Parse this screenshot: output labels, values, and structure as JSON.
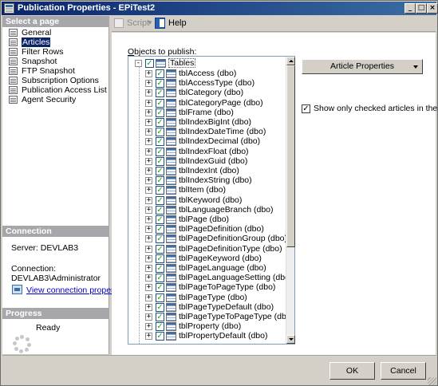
{
  "window": {
    "title": "Publication Properties - EPiTest2"
  },
  "left_pane": {
    "select_header": "Select a page",
    "pages": [
      {
        "label": "General",
        "selected": false
      },
      {
        "label": "Articles",
        "selected": true
      },
      {
        "label": "Filter Rows",
        "selected": false
      },
      {
        "label": "Snapshot",
        "selected": false
      },
      {
        "label": "FTP Snapshot",
        "selected": false
      },
      {
        "label": "Subscription Options",
        "selected": false
      },
      {
        "label": "Publication Access List",
        "selected": false
      },
      {
        "label": "Agent Security",
        "selected": false
      }
    ],
    "connection_header": "Connection",
    "server": "Server: DEVLAB3",
    "connection_label": "Connection:",
    "connection_value": "DEVLAB3\\Administrator",
    "view_link": "View connection properties",
    "progress_header": "Progress",
    "progress_status": "Ready"
  },
  "toolbar": {
    "script_label": "Script",
    "help_label": "Help"
  },
  "main": {
    "objects_label_first": "O",
    "objects_label_rest": "bjects to publish:",
    "root_label": "Tables",
    "tables": [
      "tblAccess (dbo)",
      "tblAccessType (dbo)",
      "tblCategory (dbo)",
      "tblCategoryPage (dbo)",
      "tblFrame (dbo)",
      "tblIndexBigInt (dbo)",
      "tblIndexDateTime (dbo)",
      "tblIndexDecimal (dbo)",
      "tblIndexFloat (dbo)",
      "tblIndexGuid (dbo)",
      "tblIndexInt (dbo)",
      "tblIndexString (dbo)",
      "tblItem (dbo)",
      "tblKeyword (dbo)",
      "tblLanguageBranch (dbo)",
      "tblPage (dbo)",
      "tblPageDefinition (dbo)",
      "tblPageDefinitionGroup (dbo)",
      "tblPageDefinitionType (dbo)",
      "tblPageKeyword (dbo)",
      "tblPageLanguage (dbo)",
      "tblPageLanguageSetting (dbo)",
      "tblPageToPageType (dbo)",
      "tblPageType (dbo)",
      "tblPageTypeDefault (dbo)",
      "tblPageTypeToPageType (dbo)",
      "tblProperty (dbo)",
      "tblPropertyDefault (dbo)"
    ],
    "article_properties_label": "Article Properties",
    "show_checked_label": "Show only checked articles in the list"
  },
  "buttons": {
    "ok": "OK",
    "cancel": "Cancel"
  },
  "colors": {
    "title_bar": "#0a246a",
    "selection": "#0a246a",
    "section_header": "#a7a6aa",
    "link": "#0000cc"
  },
  "icons": [
    "page-icon",
    "script-icon",
    "help-icon",
    "expand-icon",
    "checkbox-icon",
    "table-icon",
    "dropdown-arrow-icon",
    "minimize-icon",
    "maximize-icon",
    "close-icon"
  ]
}
